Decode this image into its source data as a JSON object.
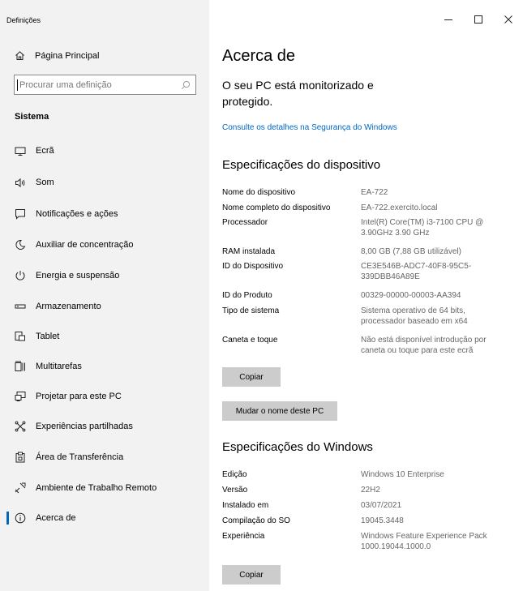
{
  "window": {
    "title": "Definições"
  },
  "sidebar": {
    "home": "Página Principal",
    "search_placeholder": "Procurar uma definição",
    "section": "Sistema",
    "items": [
      {
        "label": "Ecrã",
        "icon": "monitor-icon"
      },
      {
        "label": "Som",
        "icon": "speaker-icon"
      },
      {
        "label": "Notificações e ações",
        "icon": "notification-icon"
      },
      {
        "label": "Auxiliar de concentração",
        "icon": "moon-icon"
      },
      {
        "label": "Energia e suspensão",
        "icon": "power-icon"
      },
      {
        "label": "Armazenamento",
        "icon": "storage-icon"
      },
      {
        "label": "Tablet",
        "icon": "tablet-icon"
      },
      {
        "label": "Multitarefas",
        "icon": "multitask-icon"
      },
      {
        "label": "Projetar para este PC",
        "icon": "project-icon"
      },
      {
        "label": "Experiências partilhadas",
        "icon": "shared-icon"
      },
      {
        "label": "Área de Transferência",
        "icon": "clipboard-icon"
      },
      {
        "label": "Ambiente de Trabalho Remoto",
        "icon": "remote-icon"
      },
      {
        "label": "Acerca de",
        "icon": "info-icon",
        "active": true
      }
    ]
  },
  "main": {
    "title": "Acerca de",
    "status": "O seu PC está monitorizado e protegido.",
    "security_link": "Consulte os detalhes na Segurança do Windows",
    "device_specs": {
      "heading": "Especificações do dispositivo",
      "rows": [
        {
          "key": "Nome do dispositivo",
          "value": "EA-722"
        },
        {
          "key": "Nome completo do dispositivo",
          "value": "EA-722.exercito.local"
        },
        {
          "key": "Processador",
          "value": "Intel(R) Core(TM) i3-7100 CPU @ 3.90GHz   3.90 GHz"
        },
        {
          "key": "RAM instalada",
          "value": "8,00 GB (7,88 GB utilizável)"
        },
        {
          "key": "ID do Dispositivo",
          "value": "CE3E546B-ADC7-40F8-95C5-339DBB46A89E"
        },
        {
          "key": "ID do Produto",
          "value": "00329-00000-00003-AA394"
        },
        {
          "key": "Tipo de sistema",
          "value": "Sistema operativo de 64 bits, processador baseado em x64"
        },
        {
          "key": "Caneta e toque",
          "value": "Não está disponível introdução por caneta ou toque para este ecrã"
        }
      ],
      "copy_button": "Copiar",
      "rename_button": "Mudar o nome deste PC"
    },
    "windows_specs": {
      "heading": "Especificações do Windows",
      "rows": [
        {
          "key": "Edição",
          "value": "Windows 10 Enterprise"
        },
        {
          "key": "Versão",
          "value": "22H2"
        },
        {
          "key": "Instalado em",
          "value": "03/07/2021"
        },
        {
          "key": "Compilação do SO",
          "value": "19045.3448"
        },
        {
          "key": "Experiência",
          "value": "Windows Feature Experience Pack 1000.19044.1000.0"
        }
      ],
      "copy_button": "Copiar"
    }
  }
}
